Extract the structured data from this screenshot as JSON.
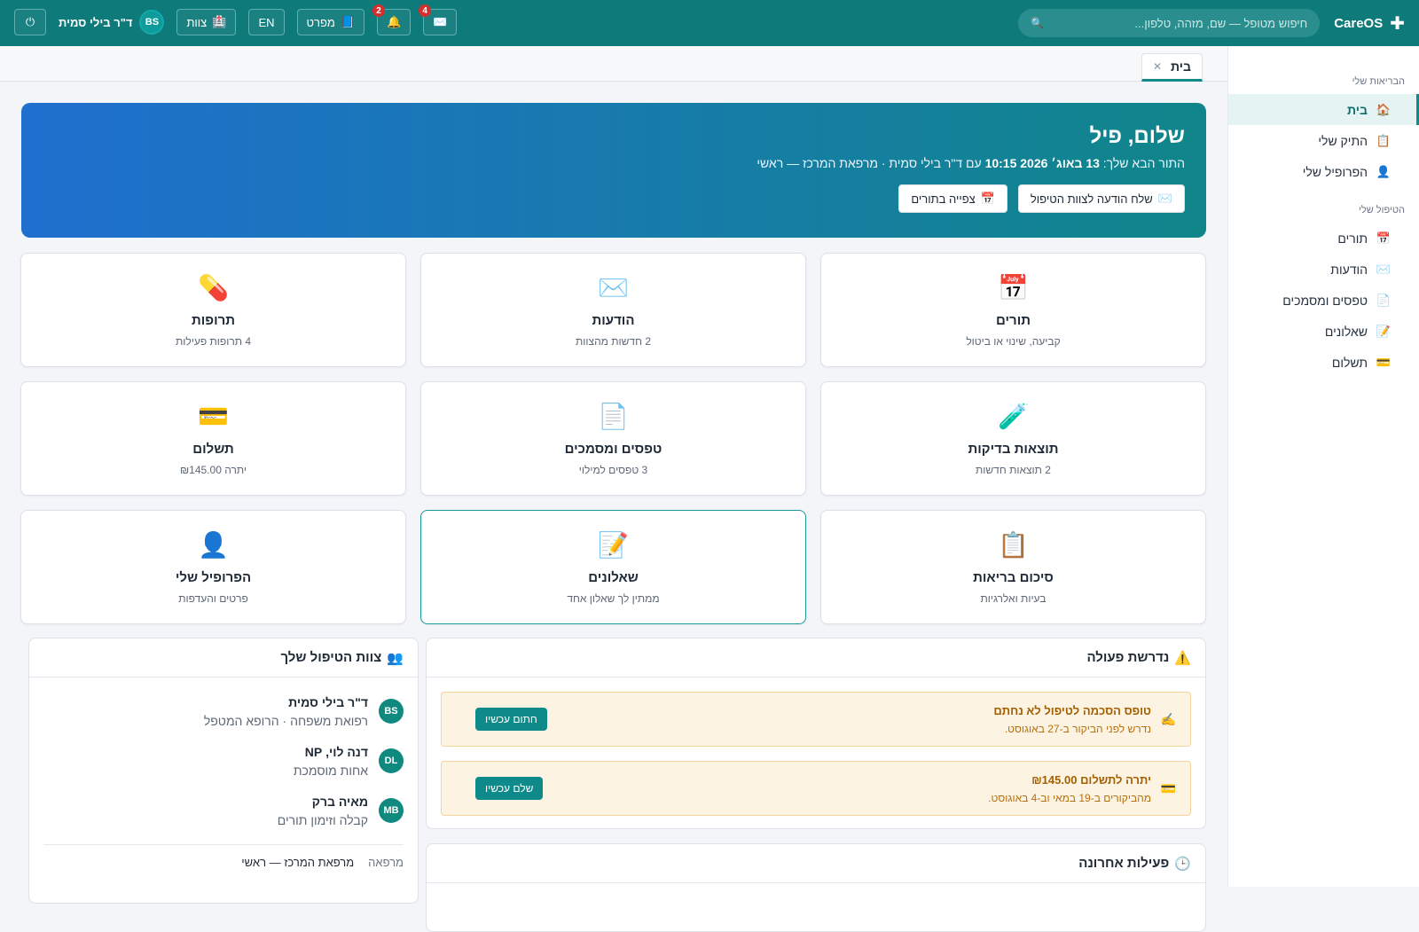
{
  "app": {
    "name": "CareOS"
  },
  "search": {
    "placeholder": "חיפוש מטופל — שם, מזהה, טלפון..."
  },
  "topbar": {
    "messages_badge": "4",
    "alerts_badge": "2",
    "guide_label": "מפרט",
    "language_label": "EN",
    "team_label": "צוות",
    "user_name": "ד\"ר בילי סמית",
    "user_initials": "BS"
  },
  "sidebar": {
    "section_health": "הבריאות שלי",
    "section_care": "הטיפול שלי",
    "items": [
      {
        "label": "בית",
        "icon": "home-icon",
        "active": true
      },
      {
        "label": "התיק שלי",
        "icon": "clipboard-icon"
      },
      {
        "label": "הפרופיל שלי",
        "icon": "person-icon"
      },
      {
        "label": "תורים",
        "icon": "calendar-icon"
      },
      {
        "label": "הודעות",
        "icon": "envelope-icon"
      },
      {
        "label": "טפסים ומסמכים",
        "icon": "document-icon"
      },
      {
        "label": "שאלונים",
        "icon": "memo-icon"
      },
      {
        "label": "תשלום",
        "icon": "credit-card-icon"
      }
    ]
  },
  "tabs": [
    {
      "label": "בית"
    }
  ],
  "hero": {
    "greeting": "שלום, פיל",
    "next_prefix": "התור הבא שלך: ",
    "next_datetime": "13 באוג׳ 2026 10:15",
    "next_suffix": " עם ד\"ר בילי סמית · מרפאת המרכז — ראשי",
    "send_message_label": "שלח הודעה לצוות הטיפול",
    "view_appointments_label": "צפייה בתורים"
  },
  "cards": [
    {
      "title": "תורים",
      "subtitle": "קביעה, שינוי או ביטול",
      "icon": "calendar-icon",
      "glyph": "📅"
    },
    {
      "title": "הודעות",
      "subtitle": "2 חדשות מהצוות",
      "icon": "envelope-icon",
      "glyph": "✉️"
    },
    {
      "title": "תרופות",
      "subtitle": "4 תרופות פעילות",
      "icon": "pill-icon",
      "glyph": "💊"
    },
    {
      "title": "תוצאות בדיקות",
      "subtitle": "2 תוצאות חדשות",
      "icon": "test-tube-icon",
      "glyph": "🧪"
    },
    {
      "title": "טפסים ומסמכים",
      "subtitle": "3 טפסים למילוי",
      "icon": "document-icon",
      "glyph": "📄"
    },
    {
      "title": "תשלום",
      "subtitle": "יתרה ₪145.00",
      "icon": "credit-card-icon",
      "glyph": "💳"
    },
    {
      "title": "סיכום בריאות",
      "subtitle": "בעיות ואלרגיות",
      "icon": "clipboard-icon",
      "glyph": "📋"
    },
    {
      "title": "שאלונים",
      "subtitle": "ממתין לך שאלון אחד",
      "icon": "memo-icon",
      "glyph": "📝"
    },
    {
      "title": "הפרופיל שלי",
      "subtitle": "פרטים והעדפות",
      "icon": "person-icon",
      "glyph": "👤"
    }
  ],
  "action_required": {
    "title": "נדרשת פעולה",
    "items": [
      {
        "title": "טופס הסכמה לטיפול לא נחתם",
        "desc": "נדרש לפני הביקור ב-27 באוגוסט.",
        "button": "חתום עכשיו",
        "icon": "writing-hand-icon"
      },
      {
        "title": "יתרה לתשלום ₪145.00",
        "desc": "מהביקורים ב-19 במאי וב-4 באוגוסט.",
        "button": "שלם עכשיו",
        "icon": "credit-card-icon"
      }
    ]
  },
  "care_team": {
    "title": "צוות הטיפול שלך",
    "members": [
      {
        "initials": "BS",
        "name": "ד\"ר בילי סמית",
        "role": "רפואת משפחה · הרופא המטפל"
      },
      {
        "initials": "DL",
        "name": "דנה לוי, NP",
        "role": "אחות מוסמכת"
      },
      {
        "initials": "MB",
        "name": "מאיה ברק",
        "role": "קבלה וזימון תורים"
      }
    ],
    "clinic_label": "מרפאה",
    "clinic_value": "מרפאת המרכז — ראשי"
  },
  "recent_activity": {
    "title": "פעילות אחרונה"
  },
  "colors": {
    "primary": "#0e7a7a",
    "accent": "#0e8a8a",
    "hero_start": "#10868a",
    "hero_end": "#1f6fcf",
    "badge": "#d32f2f",
    "warning_bg": "#fdf3e2"
  }
}
